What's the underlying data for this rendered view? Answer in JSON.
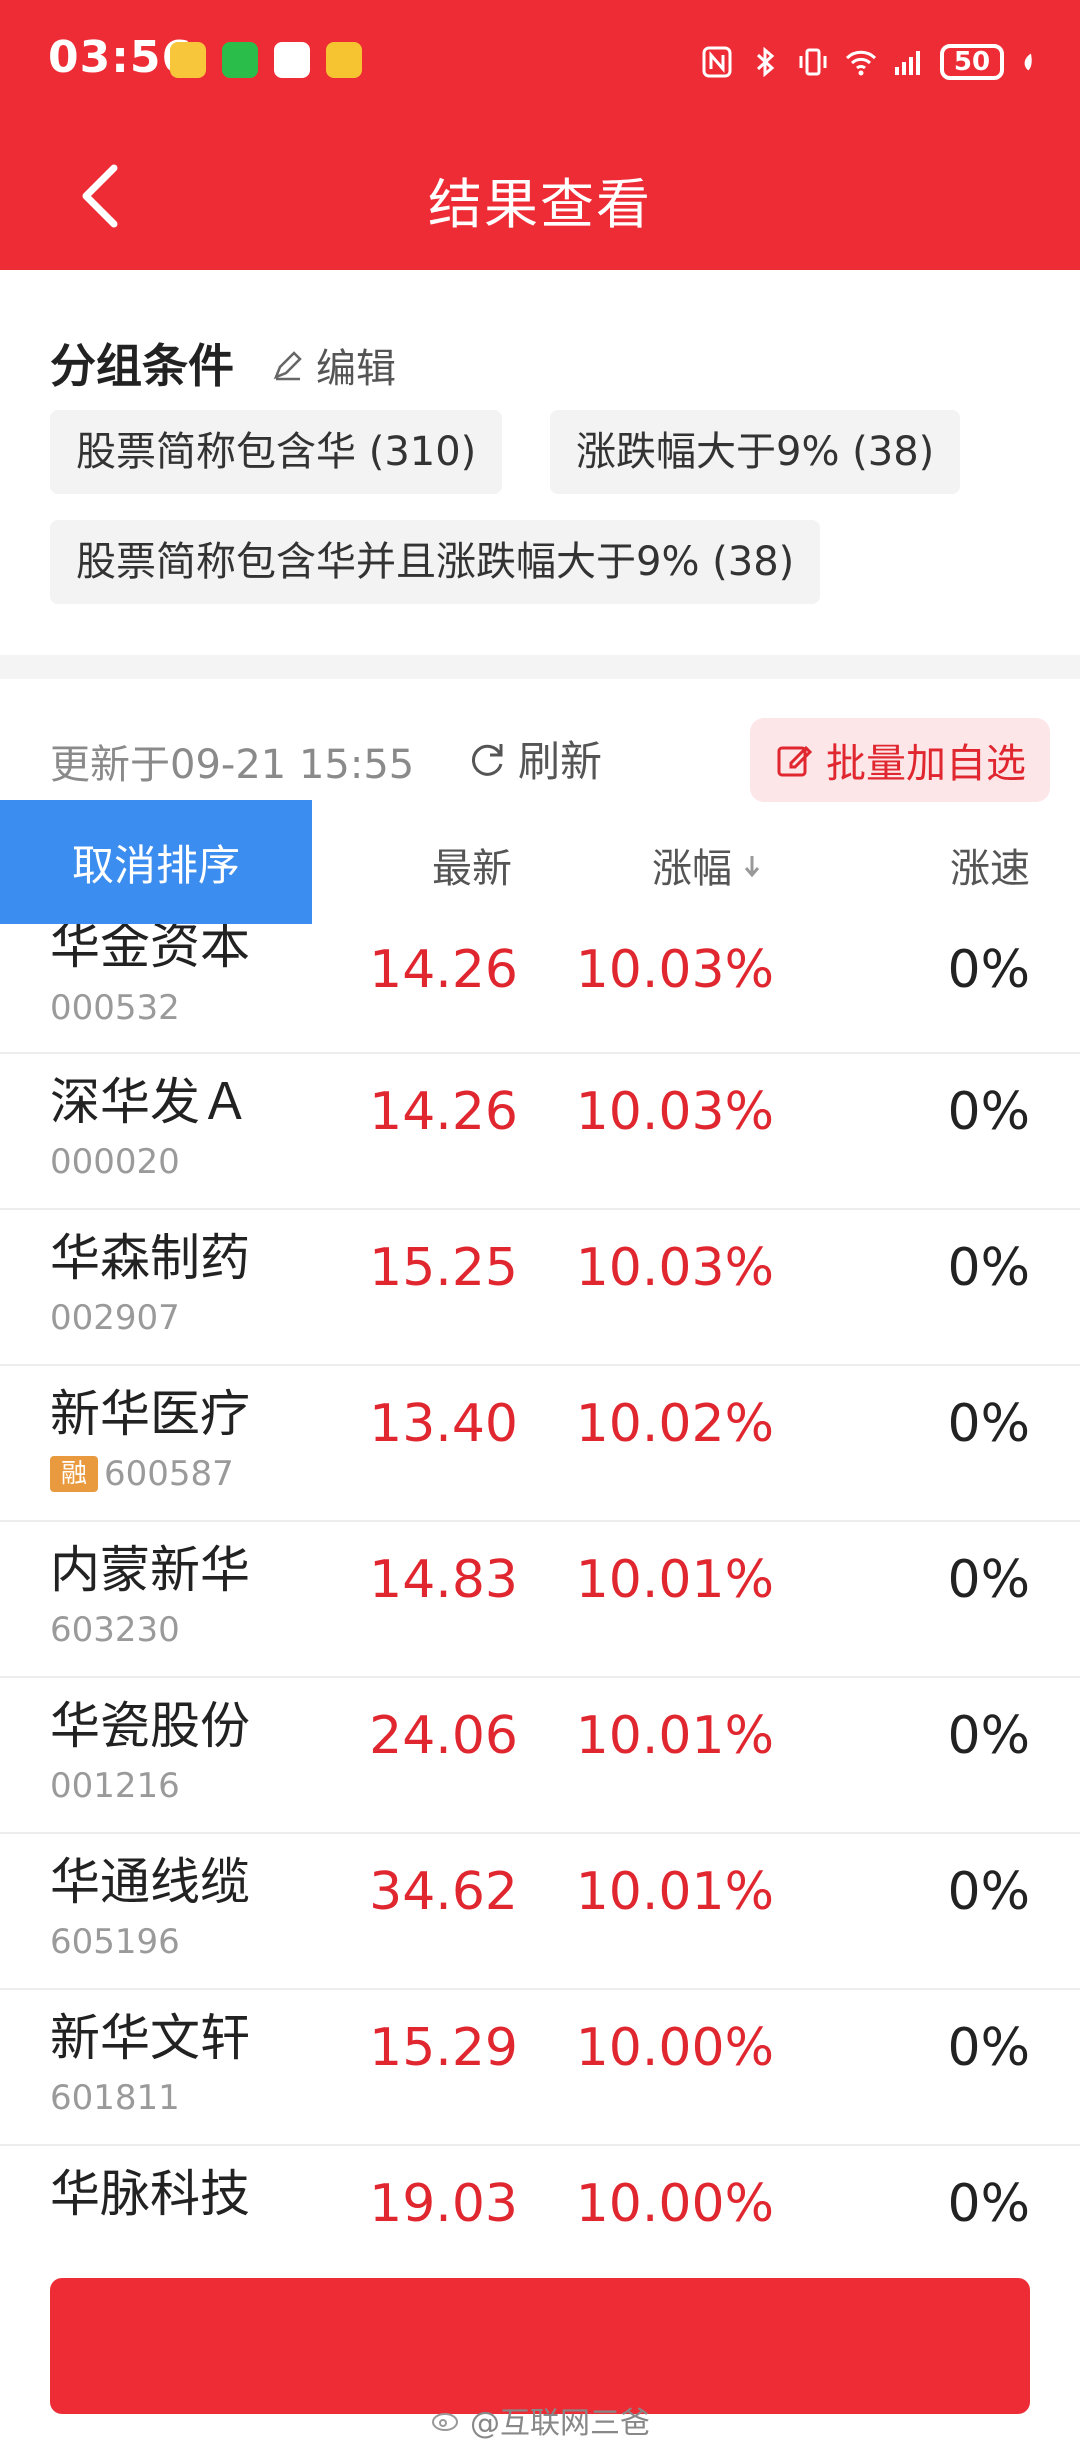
{
  "status_bar": {
    "time": "03:56",
    "battery": "50",
    "notification_icons": [
      "weibo-icon",
      "wechat-icon",
      "app-icon",
      "app-yellow-icon"
    ]
  },
  "header": {
    "title": "结果查看"
  },
  "group": {
    "title": "分组条件",
    "edit_label": "编辑",
    "chips": [
      "股票简称包含华 (310)",
      "涨跌幅大于9% (38)",
      "股票简称包含华并且涨跌幅大于9% (38)"
    ]
  },
  "toolbar": {
    "updated": "更新于09-21 15:55",
    "refresh_label": "刷新",
    "batch_label": "批量加自选"
  },
  "table": {
    "cancel_sort": "取消排序",
    "columns": {
      "latest": "最新",
      "change": "涨幅",
      "speed": "涨速"
    },
    "rows": [
      {
        "name": "华金资本",
        "code": "000532",
        "price": "14.26",
        "change": "10.03%",
        "speed": "0%",
        "badge": ""
      },
      {
        "name": "深华发Ａ",
        "code": "000020",
        "price": "14.26",
        "change": "10.03%",
        "speed": "0%",
        "badge": ""
      },
      {
        "name": "华森制药",
        "code": "002907",
        "price": "15.25",
        "change": "10.03%",
        "speed": "0%",
        "badge": ""
      },
      {
        "name": "新华医疗",
        "code": "600587",
        "price": "13.40",
        "change": "10.02%",
        "speed": "0%",
        "badge": "融"
      },
      {
        "name": "内蒙新华",
        "code": "603230",
        "price": "14.83",
        "change": "10.01%",
        "speed": "0%",
        "badge": ""
      },
      {
        "name": "华瓷股份",
        "code": "001216",
        "price": "24.06",
        "change": "10.01%",
        "speed": "0%",
        "badge": ""
      },
      {
        "name": "华通线缆",
        "code": "605196",
        "price": "34.62",
        "change": "10.01%",
        "speed": "0%",
        "badge": ""
      },
      {
        "name": "新华文轩",
        "code": "601811",
        "price": "15.29",
        "change": "10.00%",
        "speed": "0%",
        "badge": ""
      },
      {
        "name": "华脉科技",
        "code": "",
        "price": "19.03",
        "change": "10.00%",
        "speed": "0%",
        "badge": ""
      }
    ]
  },
  "watermark": "@互联网三爸",
  "colors": {
    "brand_red": "#ee2c35",
    "up_red": "#e0262f",
    "sort_blue": "#3c8df0"
  }
}
